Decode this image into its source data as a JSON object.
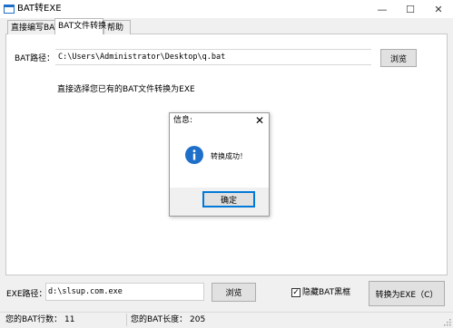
{
  "window": {
    "title": "BAT转EXE",
    "icon": "app-window-icon",
    "buttons": [
      "minimize-icon",
      "maximize-icon",
      "close-icon"
    ]
  },
  "tabs": [
    {
      "label": "直接编写BAT",
      "active": false
    },
    {
      "label": "BAT文件转换",
      "active": true
    },
    {
      "label": "帮助",
      "active": false
    }
  ],
  "bat_file": {
    "label": "BAT路径：",
    "path": "C:\\Users\\Administrator\\Desktop\\q.bat",
    "browse_label": "浏览",
    "hint": "直接选择您已有的BAT文件转换为EXE"
  },
  "dialog": {
    "title": "信息:",
    "icon": "info-icon",
    "message": "转换成功！",
    "ok_label": "确定"
  },
  "exe_output": {
    "label": "EXE路径：",
    "path": "d:\\slsup.com.exe",
    "browse_label": "浏览",
    "hide_window_label": "隐藏BAT黑框",
    "hide_window_checked": true,
    "convert_label": "转换为EXE（C）"
  },
  "status": {
    "line_count": "您的BAT行数： 11",
    "length": "您的BAT长度： 205"
  },
  "colors": {
    "accent": "#0078d7",
    "info_icon": "#1e6fc9"
  }
}
